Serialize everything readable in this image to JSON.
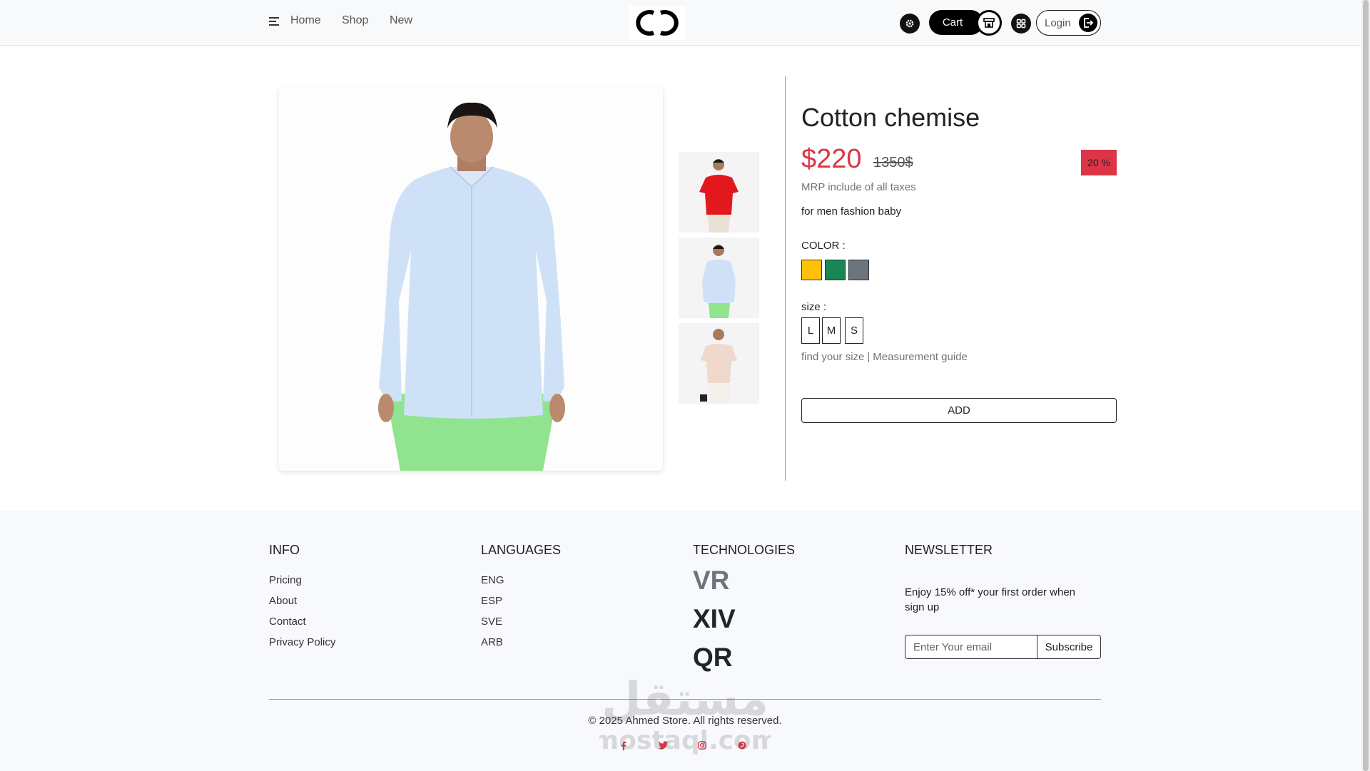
{
  "header": {
    "nav": [
      "Home",
      "Shop",
      "New"
    ],
    "cart_label": "Cart",
    "login_label": "Login",
    "icons": {
      "settings": "gear-icon",
      "store": "store-icon",
      "apps": "grid-icon",
      "login": "logout-arrow-icon",
      "menu": "hamburger-icon",
      "brand": "chanel-logo"
    }
  },
  "product": {
    "title": "Cotton chemise",
    "price": "$220",
    "old_price": "1350$",
    "discount": "20 %",
    "mrp": "MRP include of all taxes",
    "description": "for men fashion baby",
    "color_label": "COLOR :",
    "colors": [
      "#ffc107",
      "#198754",
      "#6c757d"
    ],
    "size_label": "size :",
    "sizes": [
      "L",
      "M",
      "S"
    ],
    "find_size": "find your size",
    "separator": "|",
    "measurement": "Measurement guide",
    "add_label": "ADD",
    "accent_color": "#dc3545"
  },
  "footer": {
    "info": {
      "heading": "INFO",
      "links": [
        "Pricing",
        "About",
        "Contact",
        "Privacy Policy"
      ]
    },
    "languages": {
      "heading": "LANGUAGES",
      "links": [
        "ENG",
        "ESP",
        "SVE",
        "ARB"
      ]
    },
    "technologies": {
      "heading": "TECHNOLOGIES",
      "items": [
        "VR",
        "XIV",
        "QR"
      ]
    },
    "newsletter": {
      "heading": "NEWSLETTER",
      "text": "Enjoy 15% off* your first order when sign up",
      "placeholder": "Enter Your email",
      "subscribe_label": "Subscribe"
    },
    "copyright": "© 2025 Ahmed Store. All rights reserved.",
    "social": [
      "facebook-icon",
      "twitter-icon",
      "instagram-icon",
      "pinterest-icon"
    ],
    "watermark": [
      "مستقل",
      "mostaql.com"
    ]
  }
}
